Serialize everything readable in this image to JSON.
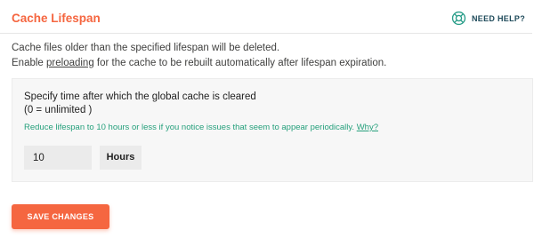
{
  "header": {
    "title": "Cache Lifespan",
    "help_label": "NEED HELP?",
    "help_icon": "lifebuoy-icon"
  },
  "description": {
    "line1": "Cache files older than the specified lifespan will be deleted.",
    "line2_before": "Enable ",
    "line2_link": "preloading",
    "line2_after": " for the cache to be rebuilt automatically after lifespan expiration."
  },
  "lifespan": {
    "label_line1": "Specify time after which the global cache is cleared",
    "label_line2": "(0 = unlimited )",
    "note_text": "Reduce lifespan to 10 hours or less if you notice issues that seem to appear periodically.",
    "note_link": "Why?",
    "value": "10",
    "unit": "Hours"
  },
  "actions": {
    "save_label": "SAVE CHANGES"
  },
  "colors": {
    "accent": "#f56640",
    "note_green": "#26a07c",
    "help_teal": "#1e4a5a"
  }
}
